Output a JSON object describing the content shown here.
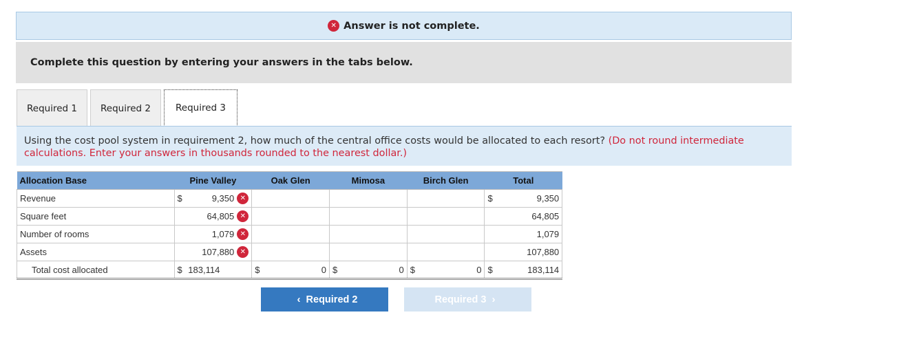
{
  "banner": {
    "text": "Answer is not complete."
  },
  "instruction": {
    "text": "Complete this question by entering your answers in the tabs below."
  },
  "tabs": [
    {
      "label": "Required 1"
    },
    {
      "label": "Required 2"
    },
    {
      "label": "Required 3"
    }
  ],
  "question": {
    "text": "Using the cost pool system in requirement 2, how much of the central office costs would be allocated to each resort?",
    "note": "(Do not round intermediate calculations. Enter your answers in thousands rounded to the nearest dollar.)"
  },
  "table": {
    "headers": [
      "Allocation Base",
      "Pine Valley",
      "Oak Glen",
      "Mimosa",
      "Birch Glen",
      "Total"
    ],
    "dollar_sign": "$",
    "rows": [
      {
        "label": "Revenue",
        "pine_valley": "9,350",
        "total": "9,350"
      },
      {
        "label": "Square feet",
        "pine_valley": "64,805",
        "total": "64,805"
      },
      {
        "label": "Number of rooms",
        "pine_valley": "1,079",
        "total": "1,079"
      },
      {
        "label": "Assets",
        "pine_valley": "107,880",
        "total": "107,880"
      }
    ],
    "total_row": {
      "label": "Total cost allocated",
      "pine_valley": "183,114",
      "oak_glen": "0",
      "mimosa": "0",
      "birch_glen": "0",
      "total": "183,114"
    }
  },
  "nav": {
    "prev_label": "Required 2",
    "next_label": "Required 3"
  },
  "colors": {
    "error": "#d0263b",
    "accent": "#3579c0",
    "header": "#7da8d8"
  }
}
